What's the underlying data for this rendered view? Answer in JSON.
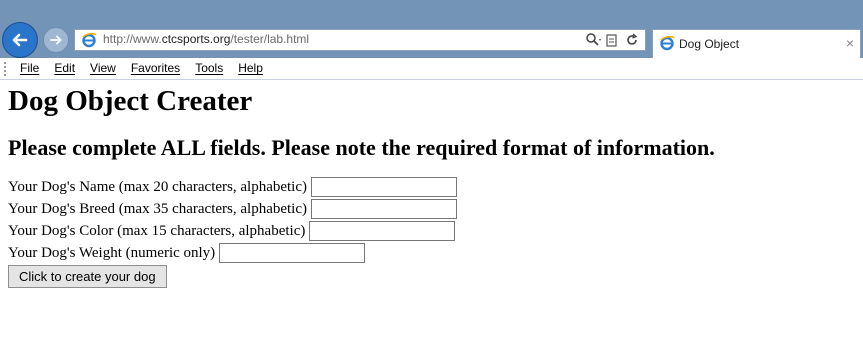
{
  "browser": {
    "url_prefix": "http://www.",
    "url_domain": "ctcsports.org",
    "url_path": "/tester/lab.html",
    "tab_title": "Dog Object",
    "tab_close": "×",
    "menu": [
      "File",
      "Edit",
      "View",
      "Favorites",
      "Tools",
      "Help"
    ]
  },
  "page": {
    "heading": "Dog Object Creater",
    "subheading": "Please complete ALL fields. Please note the required format of information.",
    "fields": [
      {
        "label": "Your Dog's Name (max 20 characters, alphabetic)",
        "value": ""
      },
      {
        "label": "Your Dog's Breed (max 35 characters, alphabetic)",
        "value": ""
      },
      {
        "label": "Your Dog's Color (max 15 characters, alphabetic)",
        "value": ""
      },
      {
        "label": "Your Dog's Weight (numeric only)",
        "value": ""
      }
    ],
    "submit_label": "Click to create your dog"
  },
  "colors": {
    "chrome": "#7393b7",
    "back_button": "#2a74c9"
  },
  "icons": {
    "back": "back-arrow-icon",
    "forward": "forward-arrow-icon",
    "site": "internet-explorer-icon",
    "search": "search-icon",
    "compat": "compatibility-view-icon",
    "refresh": "refresh-icon",
    "close": "close-icon"
  }
}
